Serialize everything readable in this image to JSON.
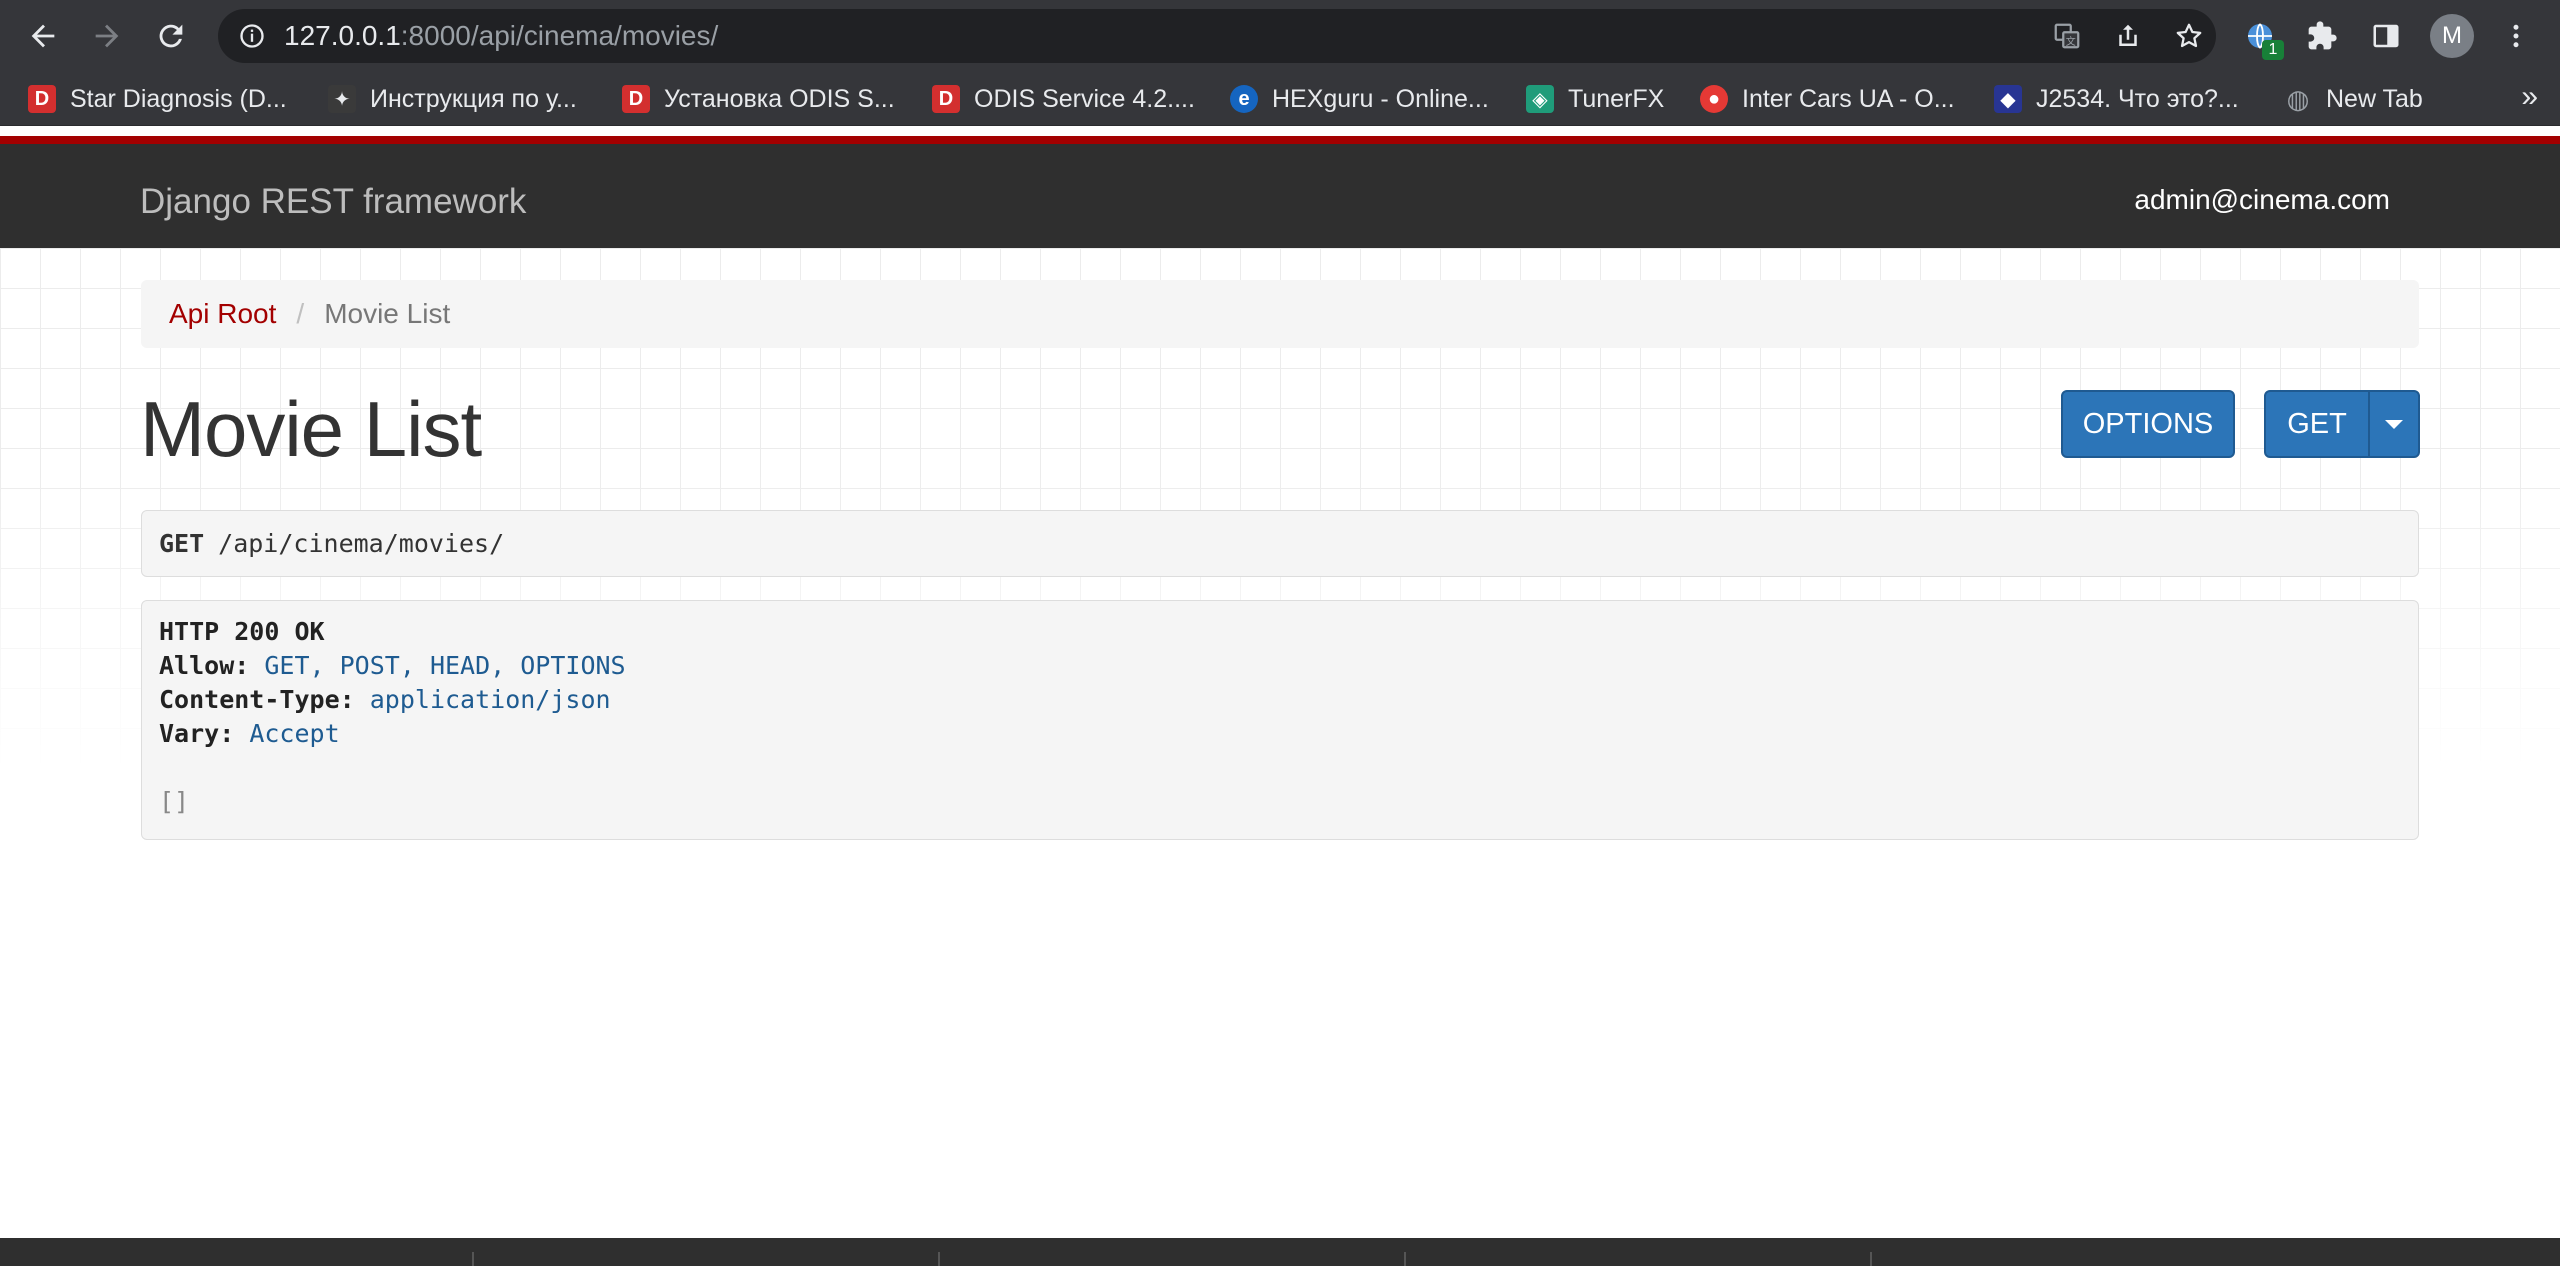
{
  "browser": {
    "url_host": "127.0.0.1",
    "url_rest": ":8000/api/cinema/movies/",
    "extension_badge": "1",
    "avatar_initial": "M",
    "bookmarks": [
      {
        "icon": "D",
        "icon_color": "#d32f2f",
        "label": "Star Diagnosis (D..."
      },
      {
        "icon": "✦",
        "icon_color": "#3a3a3a",
        "label": "Инструкция по у..."
      },
      {
        "icon": "D",
        "icon_color": "#d32f2f",
        "label": "Установка ODIS S..."
      },
      {
        "icon": "D",
        "icon_color": "#d32f2f",
        "label": "ODIS Service 4.2...."
      },
      {
        "icon": "e",
        "icon_color": "#1565c0",
        "label": "HEXguru - Online..."
      },
      {
        "icon": "◈",
        "icon_color": "#1f9c7a",
        "label": "TunerFX"
      },
      {
        "icon": "●",
        "icon_color": "#e53935",
        "label": "Inter Cars UA - O..."
      },
      {
        "icon": "◆",
        "icon_color": "#283593",
        "label": "J2534. Что это?..."
      },
      {
        "icon": "◍",
        "icon_color": "#5f6368",
        "label": "New Tab"
      }
    ],
    "more_label": "»"
  },
  "navbar": {
    "brand": "Django REST framework",
    "user": "admin@cinema.com",
    "accent_color": "#a30000"
  },
  "breadcrumb": {
    "root": "Api Root",
    "separator": "/",
    "current": "Movie List"
  },
  "page": {
    "title": "Movie List",
    "options_label": "OPTIONS",
    "get_label": "GET"
  },
  "request": {
    "method": "GET",
    "path": "/api/cinema/movies/"
  },
  "response": {
    "status": "HTTP 200 OK",
    "headers": [
      {
        "name": "Allow:",
        "value": "GET, POST, HEAD, OPTIONS"
      },
      {
        "name": "Content-Type:",
        "value": "application/json"
      },
      {
        "name": "Vary:",
        "value": "Accept"
      }
    ],
    "body": "[]"
  }
}
